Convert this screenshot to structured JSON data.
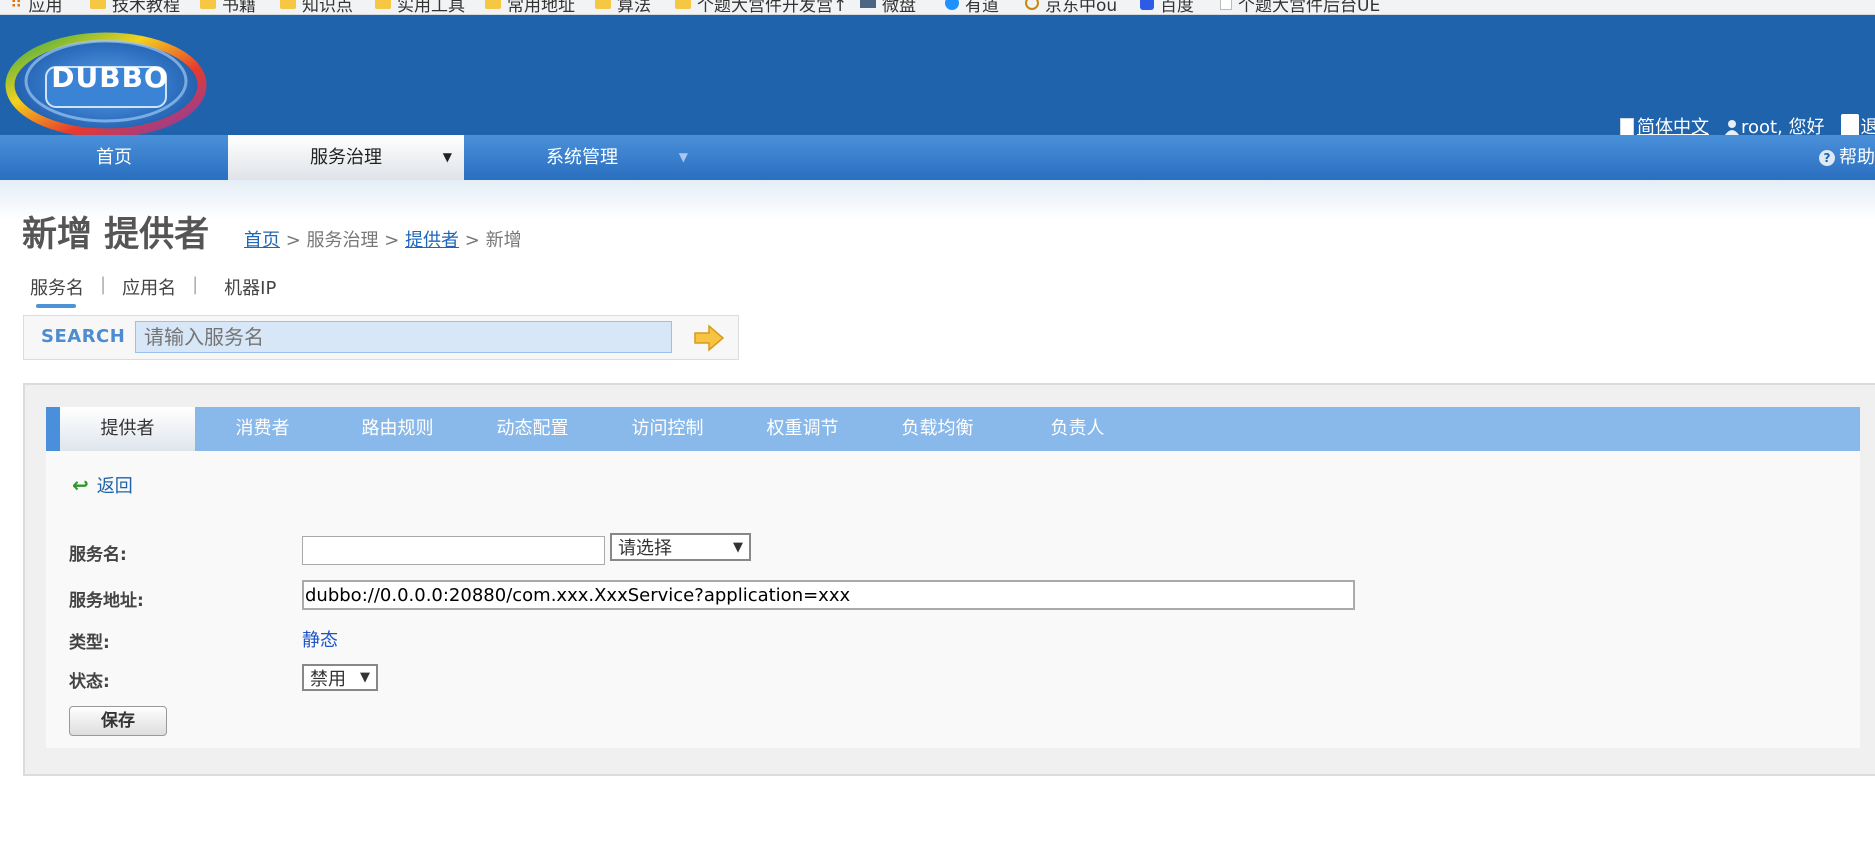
{
  "bookmarks": [
    {
      "label": "应用"
    },
    {
      "label": "技术教程"
    },
    {
      "label": "书籍"
    },
    {
      "label": "知识点"
    },
    {
      "label": "实用工具"
    },
    {
      "label": "常用地址"
    },
    {
      "label": "算法"
    },
    {
      "label": "个题大営件开发営↑"
    },
    {
      "label": "微盘"
    },
    {
      "label": "有道"
    },
    {
      "label": "京东中ou"
    },
    {
      "label": "百度"
    },
    {
      "label": "个题大営件后台UE"
    }
  ],
  "header": {
    "logo_text": "DUBBO",
    "language": "简体中文",
    "greeting": "root, 您好",
    "logout": "退"
  },
  "nav": {
    "home": "首页",
    "service_gov": "服务治理",
    "sys_admin": "系统管理",
    "help": "帮助"
  },
  "page": {
    "title": "新增 提供者",
    "breadcrumb": {
      "home": "首页",
      "sep1": " > ",
      "service_gov": "服务治理",
      "sep2": " > ",
      "providers": "提供者",
      "sep3": " > ",
      "current": "新增"
    }
  },
  "search": {
    "tabs": {
      "service": "服务名",
      "app": "应用名",
      "ip": "机器IP"
    },
    "separator": "|",
    "label": "SEARCH",
    "placeholder": "请输入服务名"
  },
  "tabs": {
    "providers": "提供者",
    "consumers": "消费者",
    "routes": "路由规则",
    "overrides": "动态配置",
    "access": "访问控制",
    "weights": "权重调节",
    "loadbalance": "负载均衡",
    "owners": "负责人"
  },
  "form": {
    "back": "返回",
    "service_label": "服务名:",
    "service_value": "",
    "service_select": "请选择",
    "address_label": "服务地址:",
    "address_value": "dubbo://0.0.0.0:20880/com.xxx.XxxService?application=xxx",
    "type_label": "类型:",
    "type_value": "静态",
    "status_label": "状态:",
    "status_value": "禁用",
    "save": "保存"
  },
  "colors": {
    "header": "#1f63ad",
    "tabbar": "#89b8ea",
    "link": "#1f63ad"
  }
}
